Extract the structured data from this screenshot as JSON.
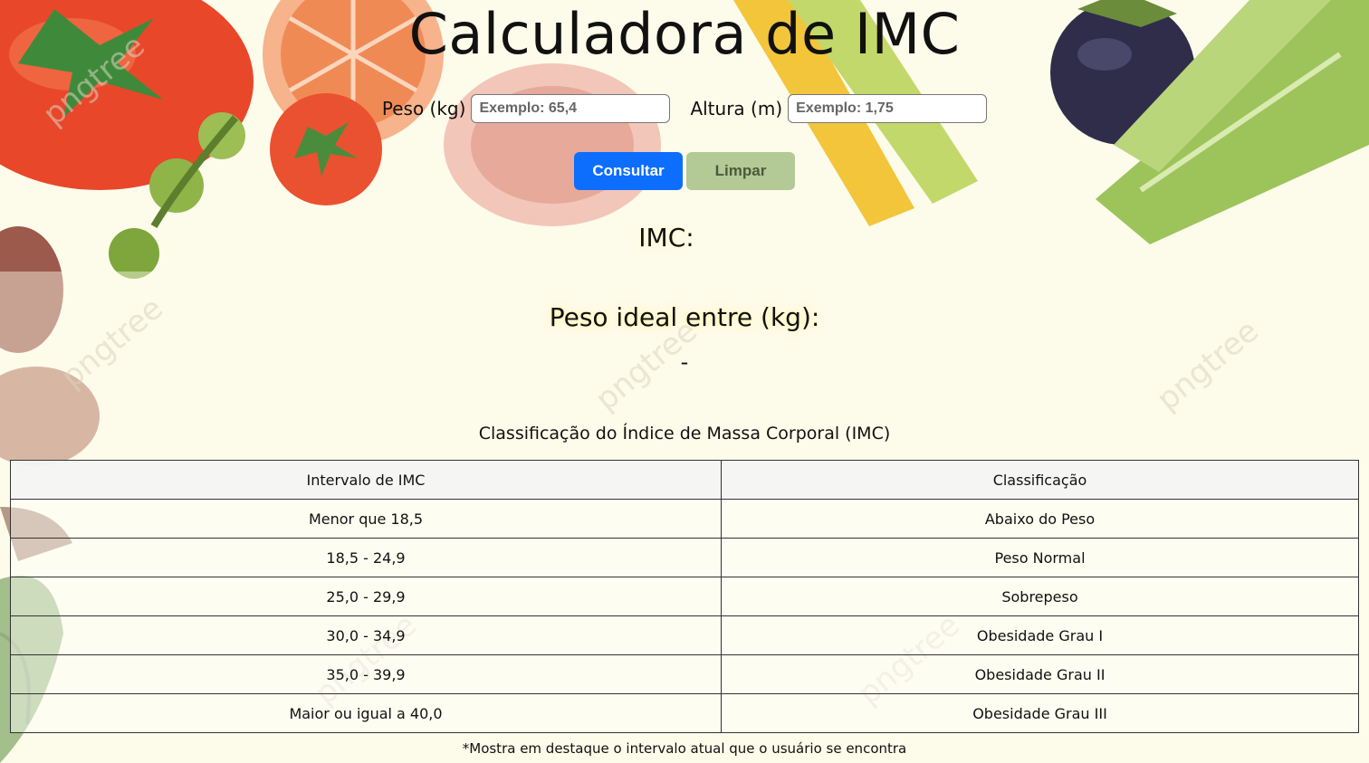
{
  "page": {
    "title": "Calculadora de IMC"
  },
  "form": {
    "weight_label": "Peso (kg)",
    "weight_placeholder": "Exemplo: 65,4",
    "weight_value": "",
    "height_label": "Altura (m)",
    "height_placeholder": "Exemplo: 1,75",
    "height_value": ""
  },
  "buttons": {
    "calculate_label": "Consultar",
    "clear_label": "Limpar"
  },
  "result": {
    "imc_label": "IMC:",
    "ideal_label": "Peso ideal entre (kg):",
    "ideal_value": "-"
  },
  "table": {
    "title": "Classificação do Índice de Massa Corporal (IMC)",
    "headers": [
      "Intervalo de IMC",
      "Classificação"
    ],
    "rows": [
      [
        "Menor que 18,5",
        "Abaixo do Peso"
      ],
      [
        "18,5 - 24,9",
        "Peso Normal"
      ],
      [
        "25,0 - 29,9",
        "Sobrepeso"
      ],
      [
        "30,0 - 34,9",
        "Obesidade Grau I"
      ],
      [
        "35,0 - 39,9",
        "Obesidade Grau II"
      ],
      [
        "Maior ou igual a 40,0",
        "Obesidade Grau III"
      ]
    ],
    "footnote": "*Mostra em destaque o intervalo atual que o usuário se encontra"
  },
  "background": {
    "watermark_text": "pngtree",
    "colors": {
      "page_bg": "#fdfbea",
      "primary_button": "#0d6efd",
      "secondary_button": "#b3c996"
    }
  }
}
